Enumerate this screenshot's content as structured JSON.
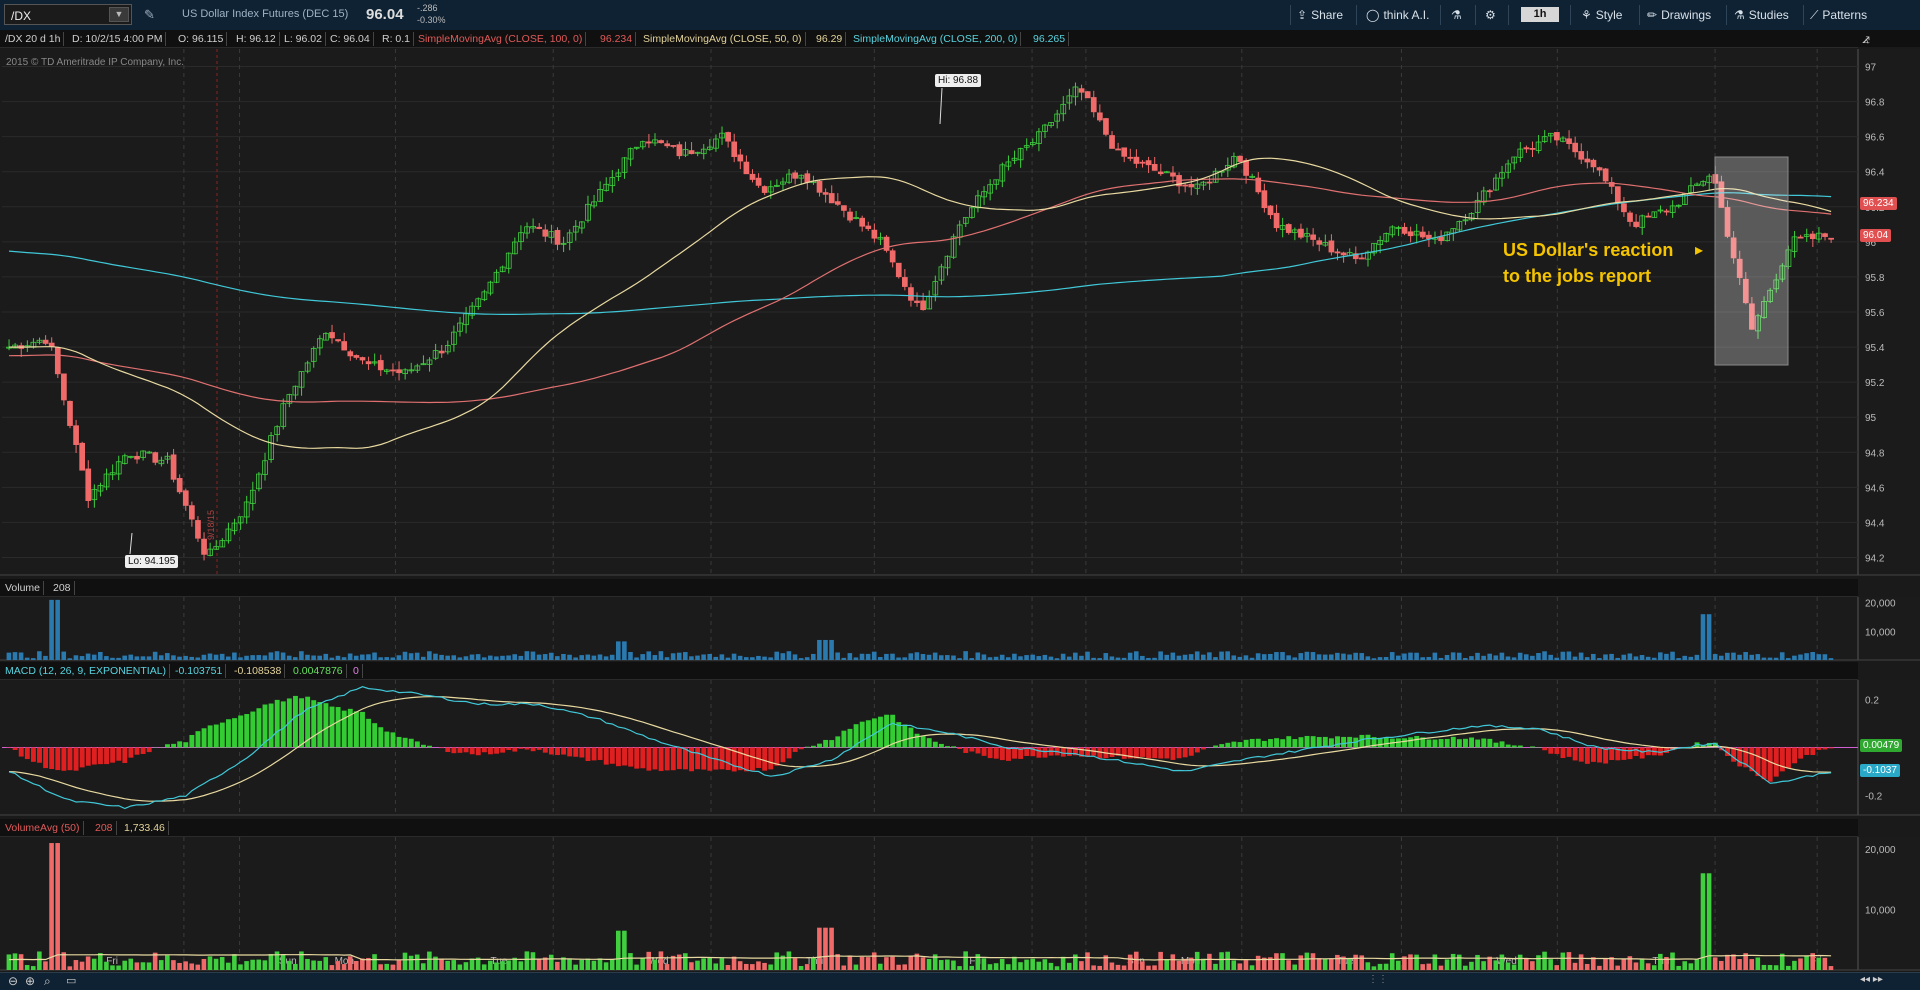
{
  "toolbar": {
    "symbol": "/DX",
    "description": "US Dollar Index Futures (DEC 15)",
    "last_price": "96.04",
    "net_change": "-.286",
    "pct_change": "-0.30%",
    "share_label": "Share",
    "thinkai_label": "think A.I.",
    "period": "1h",
    "style_label": "Style",
    "drawings_label": "Drawings",
    "studies_label": "Studies",
    "patterns_label": "Patterns"
  },
  "info_bar": {
    "chart_spec": "/DX 20 d 1h",
    "date": "D: 10/2/15 4:00 PM",
    "open": "O: 96.115",
    "high": "H: 96.12",
    "low": "L: 96.02",
    "close": "C: 96.04",
    "range": "R: 0.1",
    "sma100_label": "SimpleMovingAvg (CLOSE, 100, 0)",
    "sma100_value": "96.234",
    "sma50_label": "SimpleMovingAvg (CLOSE, 50, 0)",
    "sma50_value": "96.29",
    "sma200_label": "SimpleMovingAvg (CLOSE, 200, 0)",
    "sma200_value": "96.265"
  },
  "copyright": "2015 © TD Ameritrade IP Company, Inc.",
  "annotations": {
    "hi_label": "Hi: 96.88",
    "lo_label": "Lo: 94.195",
    "event_date": "9/18/15",
    "callout_line1": "US Dollar's reaction",
    "callout_line2": "to the jobs report",
    "sma100_badge": "96.234",
    "last_badge": "96.04"
  },
  "volume_bar": {
    "label": "Volume",
    "value": "208"
  },
  "macd_bar": {
    "label": "MACD (12, 26, 9, EXPONENTIAL)",
    "value": "-0.103751",
    "avg": "-0.108538",
    "diff": "0.0047876",
    "zero": "0"
  },
  "macd_badges": {
    "diff": "0.00479",
    "value": "-0.1037"
  },
  "volavg_bar": {
    "label": "VolumeAvg (50)",
    "value": "208",
    "avg": "1,733.46"
  },
  "colors": {
    "up": "#3fcf3f",
    "down": "#f06a6a",
    "sma50": "#e8d9a0",
    "sma100": "#e07070",
    "sma200": "#40c8d8",
    "callout": "#f5c400",
    "volume": "#2a7ab0"
  },
  "chart_data": [
    {
      "type": "candlestick",
      "title": "/DX 20 d 1h",
      "yticks": [
        "97",
        "96.8",
        "96.6",
        "96.4",
        "96.2",
        "96",
        "95.8",
        "95.6",
        "95.4",
        "95.2",
        "95",
        "94.8",
        "94.6",
        "94.4",
        "94.2"
      ],
      "ylim": [
        94.1,
        97.1
      ],
      "xticks": [
        "Fri",
        "Sun",
        "Mon",
        "Tue",
        "Wed",
        "Thu",
        "Fri",
        "Sun",
        "Mon",
        "Tue",
        "Wed",
        "Thu",
        "Fri",
        "Sun",
        "Mon"
      ],
      "anchors": [
        95.4,
        95.45,
        94.55,
        94.8,
        94.75,
        94.195,
        94.5,
        95.1,
        95.5,
        95.3,
        95.25,
        95.4,
        95.7,
        96.1,
        96.0,
        96.3,
        96.6,
        96.5,
        96.6,
        96.3,
        96.4,
        96.2,
        96.0,
        95.6,
        96.1,
        96.4,
        96.6,
        96.88,
        96.5,
        96.4,
        96.3,
        96.5,
        96.1,
        96.0,
        95.9,
        96.1,
        96.0,
        96.2,
        96.5,
        96.6,
        96.45,
        96.1,
        96.2,
        96.4,
        95.5,
        96.0,
        96.04
      ],
      "series": [
        {
          "name": "SimpleMovingAvg (CLOSE, 50, 0)",
          "last": 96.29
        },
        {
          "name": "SimpleMovingAvg (CLOSE, 100, 0)",
          "last": 96.234
        },
        {
          "name": "SimpleMovingAvg (CLOSE, 200, 0)",
          "last": 96.265
        }
      ]
    },
    {
      "type": "bar",
      "title": "Volume",
      "yticks": [
        "20,000",
        "10,000"
      ],
      "ylim": [
        0,
        22000
      ],
      "spikes": [
        {
          "at": 0.025,
          "value": 21000
        },
        {
          "at": 0.928,
          "value": 16000
        },
        {
          "at": 0.447,
          "value": 7000
        },
        {
          "at": 0.335,
          "value": 6500
        }
      ]
    },
    {
      "type": "line",
      "title": "MACD (12, 26, 9, EXPONENTIAL)",
      "yticks": [
        "0.2",
        "-0.2"
      ],
      "ylim": [
        -0.28,
        0.28
      ],
      "values": [
        -0.1,
        -0.22,
        -0.25,
        -0.2,
        -0.05,
        0.15,
        0.25,
        0.22,
        0.18,
        0.18,
        0.12,
        0.03,
        -0.05,
        -0.12,
        -0.05,
        0.1,
        0.06,
        0.0,
        -0.02,
        -0.06,
        -0.1,
        -0.05,
        -0.01,
        0.03,
        0.06,
        0.09,
        0.08,
        0.0,
        -0.02,
        0.02,
        -0.15,
        -0.1
      ]
    },
    {
      "type": "bar",
      "title": "VolumeAvg (50)",
      "yticks": [
        "20,000",
        "10,000"
      ],
      "ylim": [
        0,
        22000
      ]
    }
  ]
}
